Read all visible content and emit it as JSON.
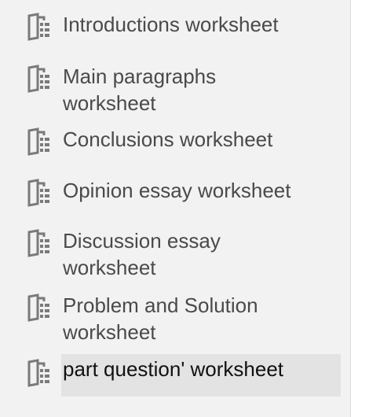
{
  "list": {
    "items": [
      {
        "label": "Introductions worksheet",
        "icon": "worksheet-icon",
        "selected": false
      },
      {
        "label": "Main paragraphs worksheet",
        "icon": "worksheet-icon",
        "selected": false
      },
      {
        "label": "Conclusions worksheet",
        "icon": "worksheet-icon",
        "selected": false
      },
      {
        "label": "Opinion essay worksheet",
        "icon": "worksheet-icon",
        "selected": false
      },
      {
        "label": "Discussion essay worksheet",
        "icon": "worksheet-icon",
        "selected": false
      },
      {
        "label": "Problem and Solution worksheet",
        "icon": "worksheet-icon",
        "selected": false
      },
      {
        "label": "part question' worksheet",
        "icon": "worksheet-icon",
        "selected": true
      }
    ]
  },
  "colors": {
    "background": "#f2f2f2",
    "text": "#4a4a4a",
    "selected_background": "#e3e3e3",
    "icon": "#7a7a7a"
  }
}
